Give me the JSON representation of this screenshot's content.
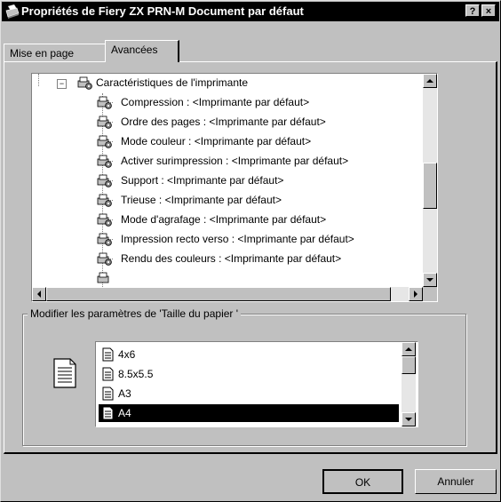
{
  "window": {
    "title": "Propriétés de Fiery ZX PRN-M Document par défaut",
    "help_label": "?",
    "close_label": "×"
  },
  "tabs": [
    {
      "label": "Mise en page"
    },
    {
      "label": "Avancées"
    }
  ],
  "tree": {
    "root": {
      "label": "Caractéristiques de l'imprimante",
      "expander": "−"
    },
    "items": [
      {
        "label": "Compression : <Imprimante par défaut>"
      },
      {
        "label": "Ordre des pages : <Imprimante par défaut>"
      },
      {
        "label": "Mode  couleur : <Imprimante par défaut>"
      },
      {
        "label": "Activer surimpression : <Imprimante par défaut>"
      },
      {
        "label": "Support : <Imprimante par défaut>"
      },
      {
        "label": "Trieuse : <Imprimante par défaut>"
      },
      {
        "label": "Mode d'agrafage : <Imprimante par défaut>"
      },
      {
        "label": "Impression recto verso : <Imprimante par défaut>"
      },
      {
        "label": "Rendu des couleurs : <Imprimante par défaut>"
      }
    ]
  },
  "modify_group": {
    "label": "Modifier les paramètres de 'Taille du papier '",
    "options": [
      {
        "label": "4x6"
      },
      {
        "label": "8.5x5.5"
      },
      {
        "label": "A3"
      },
      {
        "label": "A4"
      }
    ],
    "selected": "A4"
  },
  "buttons": {
    "ok": "OK",
    "cancel": "Annuler"
  },
  "icons": {
    "title": "printer-icon",
    "tree": "printer-settings-icon",
    "doc": "document-icon"
  },
  "colors": {
    "titlebar": "#000000",
    "face": "#c0c0c0",
    "selection": "#000000"
  }
}
